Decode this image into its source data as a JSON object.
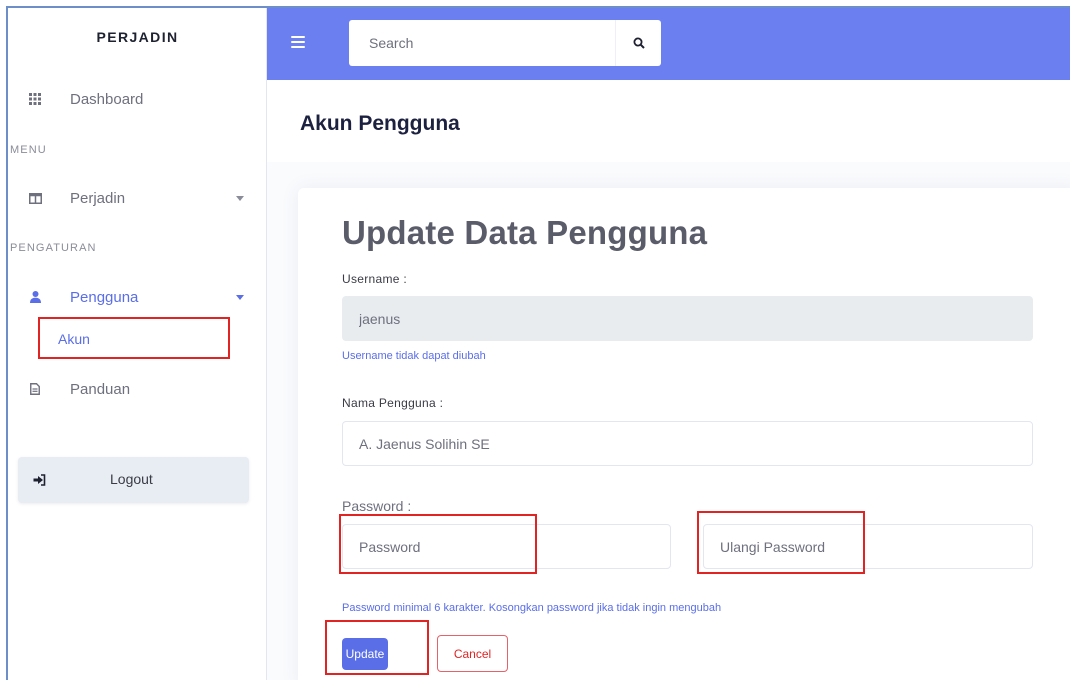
{
  "sidebar": {
    "brand": "PERJADIN",
    "dashboard": {
      "label": "Dashboard",
      "icon": "grid-icon"
    },
    "menu_heading": "MENU",
    "perjadin": {
      "label": "Perjadin",
      "icon": "columns-icon"
    },
    "settings_heading": "PENGATURAN",
    "pengguna": {
      "label": "Pengguna",
      "icon": "user-icon"
    },
    "akun": {
      "label": "Akun"
    },
    "panduan": {
      "label": "Panduan",
      "icon": "file-icon"
    },
    "logout": {
      "label": "Logout",
      "icon": "sign-out-icon"
    }
  },
  "topbar": {
    "search_placeholder": "Search",
    "search_icon": "search-icon",
    "menu_icon": "hamburger-icon"
  },
  "page": {
    "title": "Akun Pengguna"
  },
  "form": {
    "title": "Update Data Pengguna",
    "username_label": "Username :",
    "username_value": "jaenus",
    "username_hint": "Username tidak dapat diubah",
    "name_label": "Nama Pengguna :",
    "name_value": "A. Jaenus Solihin SE",
    "password_label": "Password :",
    "password_placeholder": "Password",
    "repeat_password_placeholder": "Ulangi Password",
    "password_hint": "Password minimal 6 karakter. Kosongkan password jika tidak ingin mengubah",
    "update_label": "Update",
    "cancel_label": "Cancel"
  },
  "colors": {
    "primary": "#6b7ff0",
    "accent": "#5a6ee8",
    "highlight": "#e02424"
  }
}
